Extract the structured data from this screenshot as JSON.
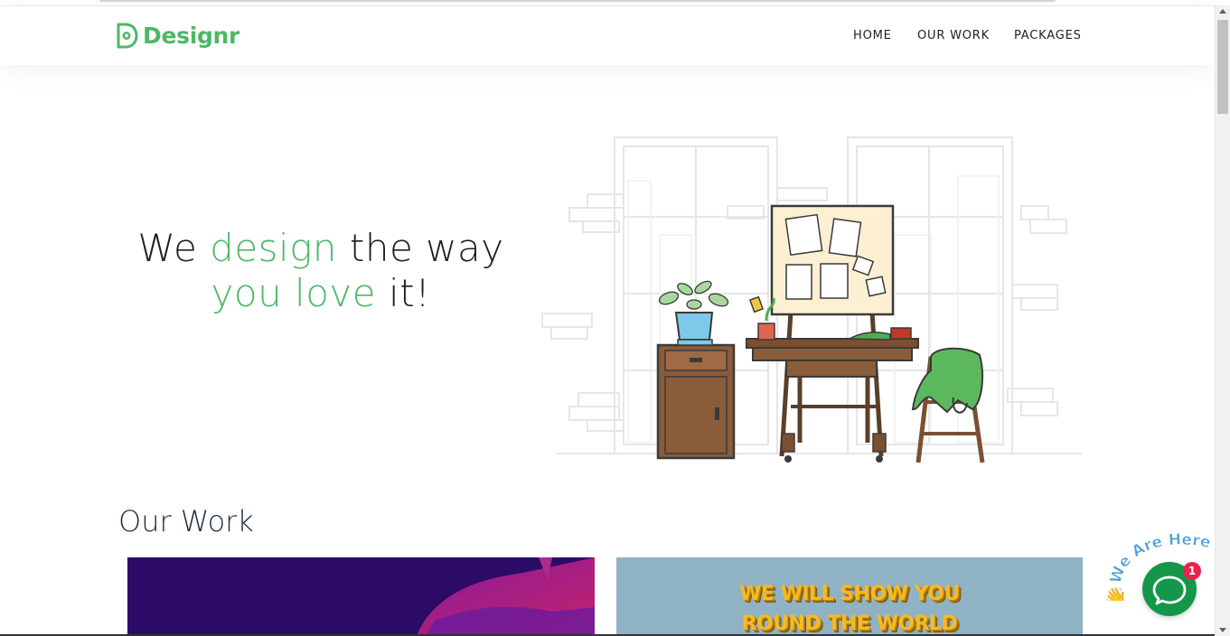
{
  "brand": {
    "name": "Designr",
    "color": "#4cb866"
  },
  "nav": {
    "items": [
      "HOME",
      "OUR WORK",
      "PACKAGES"
    ]
  },
  "hero": {
    "line1_a": "We ",
    "line1_b": "design",
    "line1_c": " the way",
    "line2_a": "you love",
    "line2_b": " it!"
  },
  "our_work": {
    "title": "Our Work",
    "card2_line1": "WE WILL SHOW YOU",
    "card2_line2": "ROUND THE WORLD"
  },
  "chat": {
    "label": "We Are Here!",
    "badge": "1",
    "wave": "👋"
  }
}
